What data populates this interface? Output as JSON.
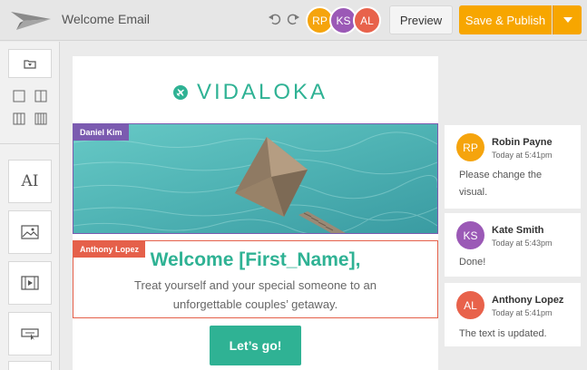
{
  "header": {
    "title": "Welcome Email",
    "preview_label": "Preview",
    "publish_label": "Save & Publish",
    "avatars": [
      {
        "initials": "RP",
        "color": "#f5a40d"
      },
      {
        "initials": "KS",
        "color": "#9b59b6"
      },
      {
        "initials": "AL",
        "color": "#e8624b"
      }
    ]
  },
  "sidebar": {
    "items": [
      "folder-icon",
      "one-column-icon",
      "two-column-icon",
      "three-column-icon",
      "four-column-icon",
      "text-tool-icon",
      "image-tool-icon",
      "video-tool-icon",
      "button-tool-icon"
    ],
    "text_tool_label": "AI"
  },
  "email": {
    "brand": "VIDALOKA",
    "image_editor": "Daniel Kim",
    "text_editor": "Anthony Lopez",
    "heading": "Welcome [First_Name],",
    "body": "Treat yourself and your special someone to an unforgettable couples’ getaway.",
    "cta": "Let’s go!"
  },
  "comments": [
    {
      "initials": "RP",
      "color": "#f5a40d",
      "name": "Robin Payne",
      "time": "Today at 5:41pm",
      "text": "Please change the visual."
    },
    {
      "initials": "KS",
      "color": "#9b59b6",
      "name": "Kate Smith",
      "time": "Today at 5:43pm",
      "text": "Done!"
    },
    {
      "initials": "AL",
      "color": "#e8624b",
      "name": "Anthony Lopez",
      "time": "Today at 5:41pm",
      "text": "The text is updated."
    }
  ],
  "colors": {
    "accent": "#2fb294",
    "publish": "#f7a600",
    "image_selection": "#7b5bb0",
    "text_selection": "#e5604a"
  }
}
